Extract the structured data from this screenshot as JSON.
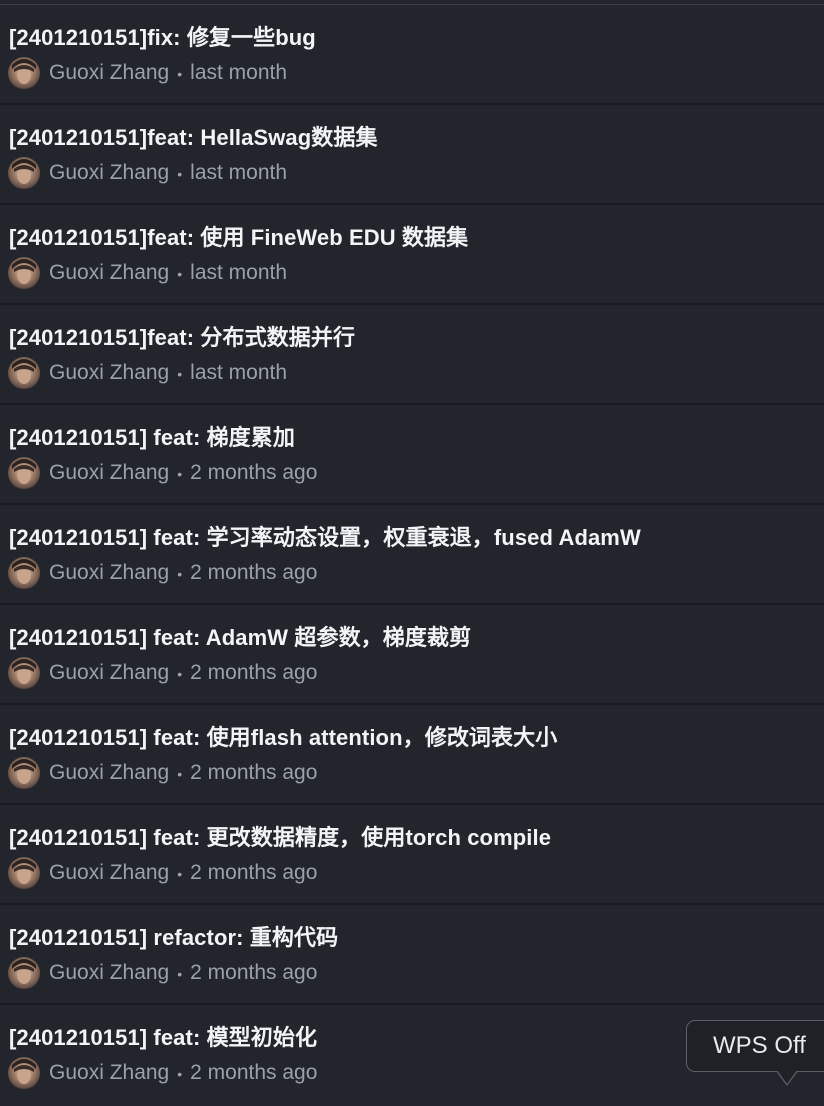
{
  "commits": [
    {
      "title": "[2401210151]fix: 修复一些bug",
      "author": "Guoxi Zhang",
      "separator": "•",
      "time": "last month"
    },
    {
      "title": "[2401210151]feat: HellaSwag数据集",
      "author": "Guoxi Zhang",
      "separator": "•",
      "time": "last month"
    },
    {
      "title": "[2401210151]feat: 使用 FineWeb EDU 数据集",
      "author": "Guoxi Zhang",
      "separator": "•",
      "time": "last month"
    },
    {
      "title": "[2401210151]feat: 分布式数据并行",
      "author": "Guoxi Zhang",
      "separator": "•",
      "time": "last month"
    },
    {
      "title": "[2401210151] feat: 梯度累加",
      "author": "Guoxi Zhang",
      "separator": "•",
      "time": "2 months ago"
    },
    {
      "title": "[2401210151] feat: 学习率动态设置，权重衰退，fused AdamW",
      "author": "Guoxi Zhang",
      "separator": "•",
      "time": "2 months ago"
    },
    {
      "title": "[2401210151] feat: AdamW 超参数，梯度裁剪",
      "author": "Guoxi Zhang",
      "separator": "•",
      "time": "2 months ago"
    },
    {
      "title": "[2401210151] feat: 使用flash attention，修改词表大小",
      "author": "Guoxi Zhang",
      "separator": "•",
      "time": "2 months ago"
    },
    {
      "title": "[2401210151] feat: 更改数据精度，使用torch compile",
      "author": "Guoxi Zhang",
      "separator": "•",
      "time": "2 months ago"
    },
    {
      "title": "[2401210151] refactor: 重构代码",
      "author": "Guoxi Zhang",
      "separator": "•",
      "time": "2 months ago"
    },
    {
      "title": "[2401210151] feat: 模型初始化",
      "author": "Guoxi Zhang",
      "separator": "•",
      "time": "2 months ago"
    }
  ],
  "tooltip": {
    "text": "WPS Off"
  },
  "colors": {
    "background": "#22262c",
    "title": "#f3f4f6",
    "meta": "#9ba1a8",
    "divider": "#181b1f"
  },
  "icons": {
    "avatar": "avatar-icon"
  }
}
